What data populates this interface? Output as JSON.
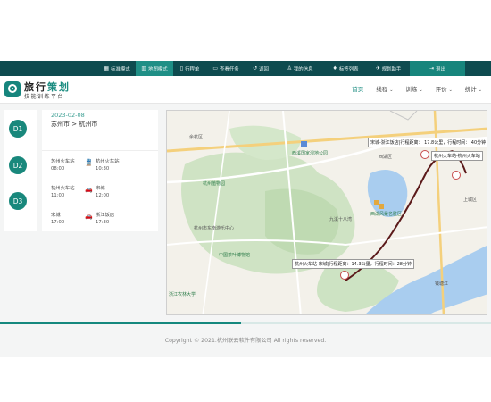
{
  "topbar": {
    "items": [
      {
        "label": "标准模式",
        "icon": "grid-icon"
      },
      {
        "label": "地图模式",
        "icon": "map-icon"
      },
      {
        "label": "行程单",
        "icon": "list-icon"
      },
      {
        "label": "查看任务",
        "icon": "task-icon"
      },
      {
        "label": "返回",
        "icon": "back-icon"
      },
      {
        "label": "我的信息",
        "icon": "user-icon"
      },
      {
        "label": "标签列表",
        "icon": "tag-icon"
      },
      {
        "label": "规划助手",
        "icon": "compass-icon"
      },
      {
        "label": "退出",
        "icon": "exit-icon"
      }
    ]
  },
  "header": {
    "brand_main": "旅行",
    "brand_accent": "策划",
    "brand_sub": "技能训练平台",
    "nav": [
      {
        "label": "首页",
        "has_menu": false
      },
      {
        "label": "线程",
        "has_menu": true
      },
      {
        "label": "训练",
        "has_menu": true
      },
      {
        "label": "评价",
        "has_menu": true
      },
      {
        "label": "统计",
        "has_menu": true
      }
    ]
  },
  "days": [
    "D1",
    "D2",
    "D3"
  ],
  "trip": {
    "date": "2023-02-08",
    "route": "苏州市 > 杭州市",
    "segments": [
      {
        "from": "苏州火车站",
        "from_time": "08:00",
        "to": "杭州火车站",
        "to_time": "10:30",
        "mode_icon": "train-icon"
      },
      {
        "from": "杭州火车站",
        "from_time": "11:00",
        "to": "宋城",
        "to_time": "12:00",
        "mode_icon": "car-icon"
      },
      {
        "from": "宋城",
        "from_time": "17:00",
        "to": "浙江饭店",
        "to_time": "17:30",
        "mode_icon": "car-icon"
      }
    ]
  },
  "map": {
    "labels": [
      "余杭区",
      "西湖区",
      "上城区",
      "西溪国家湿地公园",
      "西湖风景名胜区",
      "杭州植物园",
      "杭州市东南游乐中心",
      "中国茶叶博物馆",
      "浙江农林大学",
      "九溪十八湾",
      "钱塘江"
    ],
    "tooltips": [
      {
        "text": "宋城-浙江饭店|行程距离： 17.8公里，行程时间： 40分钟"
      },
      {
        "text": "杭州火车站-杭州火车站"
      },
      {
        "text": "杭州火车站-宋城|行程距离：14.3公里，行程时间：28分钟"
      }
    ]
  },
  "footer": "Copyright © 2021.杭州联云软件有限公司 All rights reserved."
}
